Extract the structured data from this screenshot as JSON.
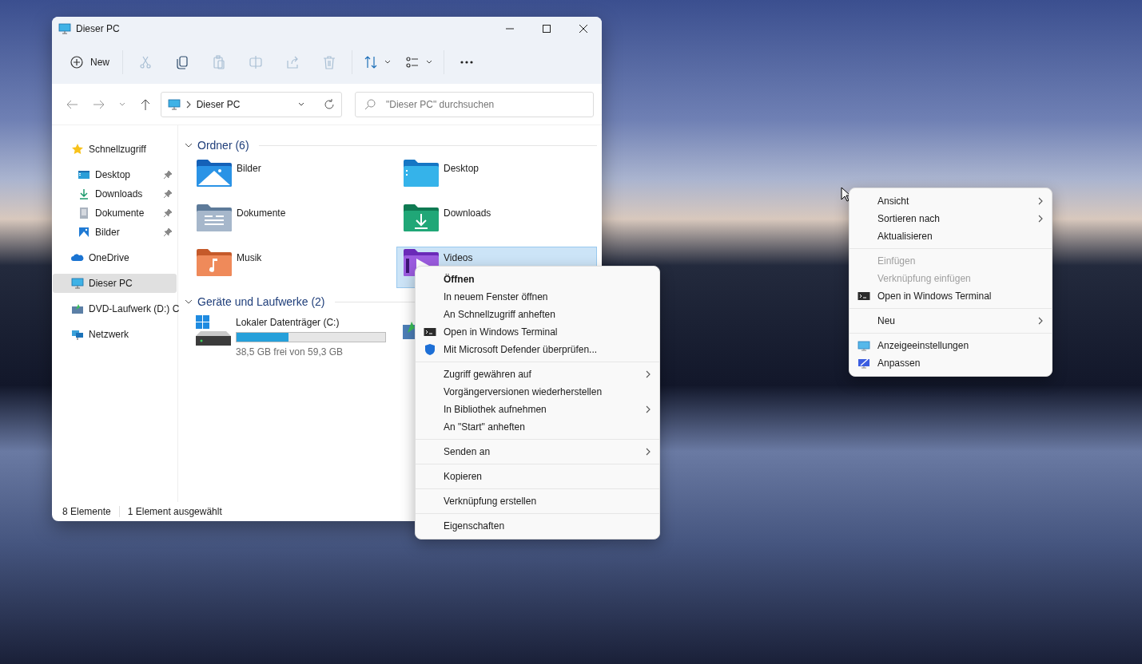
{
  "window": {
    "title": "Dieser PC"
  },
  "toolbar": {
    "buttons": [
      {
        "kind": "new",
        "label": "New",
        "disabled": false
      },
      {
        "kind": "cut",
        "disabled": true
      },
      {
        "kind": "copy",
        "disabled": false
      },
      {
        "kind": "paste",
        "disabled": true
      },
      {
        "kind": "rename",
        "disabled": true
      },
      {
        "kind": "share",
        "disabled": true
      },
      {
        "kind": "delete",
        "disabled": true
      },
      {
        "kind": "sort",
        "disabled": false
      },
      {
        "kind": "view",
        "disabled": false
      },
      {
        "kind": "more",
        "disabled": false
      }
    ]
  },
  "address": {
    "location": "Dieser PC"
  },
  "search": {
    "placeholder": "\"Dieser PC\" durchsuchen"
  },
  "sidebar": {
    "items": [
      {
        "label": "Schnellzugriff",
        "kind": "star",
        "selected": false,
        "children": [
          {
            "label": "Desktop",
            "kind": "desktop",
            "pinned": true,
            "selected": false
          },
          {
            "label": "Downloads",
            "kind": "downloads",
            "pinned": true,
            "selected": false
          },
          {
            "label": "Dokumente",
            "kind": "documents",
            "pinned": true,
            "selected": false
          },
          {
            "label": "Bilder",
            "kind": "pictures",
            "pinned": true,
            "selected": false
          }
        ]
      },
      {
        "label": "OneDrive",
        "kind": "cloud",
        "selected": false
      },
      {
        "label": "Dieser PC",
        "kind": "pc",
        "selected": true
      },
      {
        "label": "DVD-Laufwerk (D:) C",
        "kind": "dvd",
        "selected": false
      },
      {
        "label": "Netzwerk",
        "kind": "network",
        "selected": false
      }
    ]
  },
  "folders": {
    "title": "Ordner (6)",
    "expanded": true,
    "items": [
      {
        "name": "Bilder",
        "kind": "pictures",
        "selected": false
      },
      {
        "name": "Desktop",
        "kind": "desktop",
        "selected": false
      },
      {
        "name": "Dokumente",
        "kind": "documents",
        "selected": false
      },
      {
        "name": "Downloads",
        "kind": "downloads",
        "selected": false
      },
      {
        "name": "Musik",
        "kind": "music",
        "selected": false
      },
      {
        "name": "Videos",
        "kind": "videos",
        "selected": true
      }
    ]
  },
  "drives": {
    "title": "Geräte und Laufwerke (2)",
    "expanded": true,
    "items": [
      {
        "kind": "hdd",
        "name": "Lokaler Datenträger (C:)",
        "level": 0.35,
        "free": "38,5 GB frei von 59,3 GB"
      },
      {
        "kind": "dvd"
      }
    ]
  },
  "status_bar": {
    "items": [
      "8 Elemente",
      "1 Element ausgewählt"
    ]
  },
  "context_menu": {
    "groups": [
      [
        {
          "label": "Öffnen",
          "default": true,
          "submenu": false
        },
        {
          "label": "In neuem Fenster öffnen",
          "default": false,
          "submenu": false
        },
        {
          "label": "An Schnellzugriff anheften",
          "default": false,
          "submenu": false
        },
        {
          "label": "Open in Windows Terminal",
          "kind": "terminal",
          "default": false,
          "submenu": false
        },
        {
          "label": "Mit Microsoft Defender überprüfen...",
          "kind": "shield",
          "default": false,
          "submenu": false
        }
      ],
      [
        {
          "label": "Zugriff gewähren auf",
          "default": false,
          "submenu": true
        },
        {
          "label": "Vorgängerversionen wiederherstellen",
          "default": false,
          "submenu": false
        },
        {
          "label": "In Bibliothek aufnehmen",
          "default": false,
          "submenu": true
        },
        {
          "label": "An \"Start\" anheften",
          "default": false,
          "submenu": false
        }
      ],
      [
        {
          "label": "Senden an",
          "default": false,
          "submenu": true
        }
      ],
      [
        {
          "label": "Kopieren",
          "default": false,
          "submenu": false
        }
      ],
      [
        {
          "label": "Verknüpfung erstellen",
          "default": false,
          "submenu": false
        }
      ],
      [
        {
          "label": "Eigenschaften",
          "default": false,
          "submenu": false
        }
      ]
    ]
  },
  "desktop_menu": {
    "groups": [
      [
        {
          "label": "Ansicht",
          "disabled": false,
          "submenu": true
        },
        {
          "label": "Sortieren nach",
          "disabled": false,
          "submenu": true
        },
        {
          "label": "Aktualisieren",
          "disabled": false,
          "submenu": false
        }
      ],
      [
        {
          "label": "Einfügen",
          "disabled": true,
          "submenu": false
        },
        {
          "label": "Verknüpfung einfügen",
          "disabled": true,
          "submenu": false
        },
        {
          "label": "Open in Windows Terminal",
          "kind": "terminal",
          "disabled": false,
          "submenu": false
        }
      ],
      [
        {
          "label": "Neu",
          "disabled": false,
          "submenu": true
        }
      ],
      [
        {
          "label": "Anzeigeeinstellungen",
          "kind": "display",
          "disabled": false,
          "submenu": false
        },
        {
          "label": "Anpassen",
          "kind": "personalize",
          "disabled": false,
          "submenu": false
        }
      ]
    ]
  }
}
